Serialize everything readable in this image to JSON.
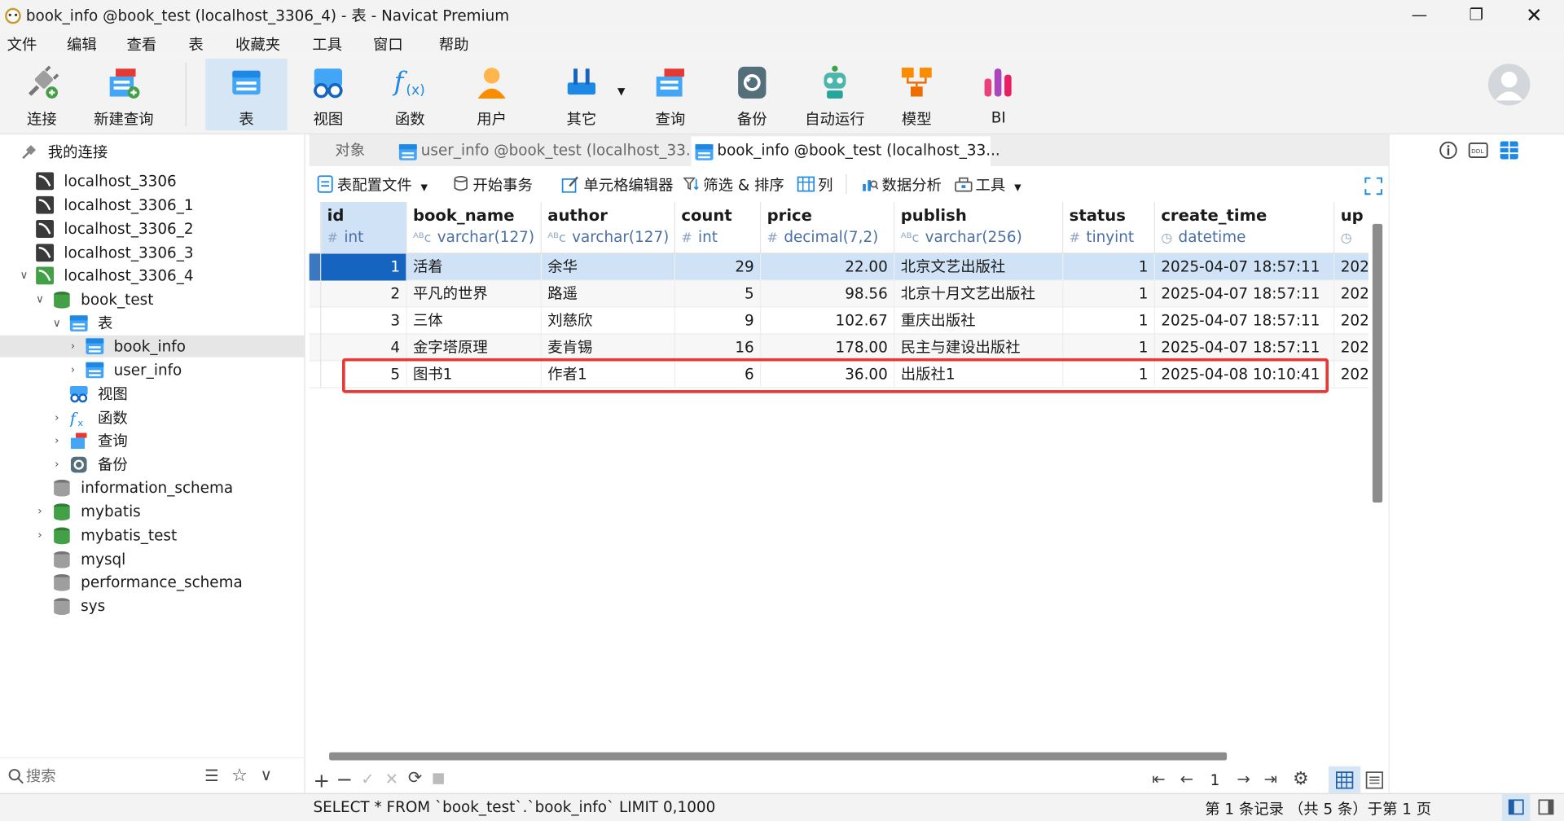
{
  "window": {
    "title": "book_info @book_test (localhost_3306_4) - 表 - Navicat Premium"
  },
  "menu": [
    "文件",
    "编辑",
    "查看",
    "表",
    "收藏夹",
    "工具",
    "窗口",
    "帮助"
  ],
  "toolbar": [
    "连接",
    "新建查询",
    "表",
    "视图",
    "函数",
    "用户",
    "其它",
    "查询",
    "备份",
    "自动运行",
    "模型",
    "BI"
  ],
  "tree": {
    "root": "我的连接",
    "connections": [
      "localhost_3306",
      "localhost_3306_1",
      "localhost_3306_2",
      "localhost_3306_3",
      "localhost_3306_4"
    ],
    "db": "book_test",
    "tables_group": "表",
    "tables": [
      "book_info",
      "user_info"
    ],
    "groups": [
      "视图",
      "函数",
      "查询",
      "备份"
    ],
    "other_dbs": [
      "information_schema",
      "mybatis",
      "mybatis_test",
      "mysql",
      "performance_schema",
      "sys"
    ],
    "search_placeholder": "搜索"
  },
  "tabs": [
    "对象",
    "user_info @book_test (localhost_33...",
    "book_info @book_test (localhost_33..."
  ],
  "subtoolbar": [
    "表配置文件",
    "开始事务",
    "单元格编辑器",
    "筛选 & 排序",
    "列",
    "数据分析",
    "工具"
  ],
  "columns": [
    {
      "name": "id",
      "type": "int"
    },
    {
      "name": "book_name",
      "type": "varchar(127)"
    },
    {
      "name": "author",
      "type": "varchar(127)"
    },
    {
      "name": "count",
      "type": "int"
    },
    {
      "name": "price",
      "type": "decimal(7,2)"
    },
    {
      "name": "publish",
      "type": "varchar(256)"
    },
    {
      "name": "status",
      "type": "tinyint"
    },
    {
      "name": "create_time",
      "type": "datetime"
    },
    {
      "name": "up",
      "type": ""
    }
  ],
  "rows": [
    [
      "1",
      "活着",
      "余华",
      "29",
      "22.00",
      "北京文艺出版社",
      "1",
      "2025-04-07 18:57:11",
      "202"
    ],
    [
      "2",
      "平凡的世界",
      "路遥",
      "5",
      "98.56",
      "北京十月文艺出版社",
      "1",
      "2025-04-07 18:57:11",
      "202"
    ],
    [
      "3",
      "三体",
      "刘慈欣",
      "9",
      "102.67",
      "重庆出版社",
      "1",
      "2025-04-07 18:57:11",
      "202"
    ],
    [
      "4",
      "金字塔原理",
      "麦肯锡",
      "16",
      "178.00",
      "民主与建设出版社",
      "1",
      "2025-04-07 18:57:11",
      "202"
    ],
    [
      "5",
      "图书1",
      "作者1",
      "6",
      "36.00",
      "出版社1",
      "1",
      "2025-04-08 10:10:41",
      "202"
    ]
  ],
  "pager": {
    "page": "1"
  },
  "status": {
    "sql": "SELECT * FROM `book_test`.`book_info` LIMIT 0,1000",
    "records": "第 1 条记录 （共 5 条）于第 1 页"
  },
  "colors": {
    "accent": "#1e88e5",
    "highlight": "#e53935",
    "selected_row": "#cfe2f6"
  }
}
